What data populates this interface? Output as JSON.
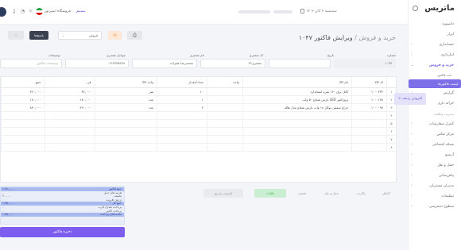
{
  "sidebar": {
    "brand": "ماتریس",
    "items": [
      {
        "label": "داشبورد",
        "type": "plain"
      },
      {
        "label": "ابزار",
        "type": "plain"
      },
      {
        "label": "حسابداری",
        "type": "collapsed"
      },
      {
        "label": "انبارداری",
        "type": "collapsed"
      },
      {
        "label": "خرید و فروش",
        "type": "open"
      },
      {
        "label": "ثبت فاکتور",
        "type": "sub"
      },
      {
        "label": "لیست فاکتورها",
        "type": "sub-active"
      },
      {
        "label": "گزارش",
        "type": "collapsed"
      },
      {
        "label": "خزانه داری",
        "type": "collapsed"
      },
      {
        "label": "مدیریت وظایف",
        "type": "group"
      },
      {
        "label": "کنترل سفارشات",
        "type": "collapsed"
      },
      {
        "label": "مرکز تماس",
        "type": "collapsed"
      },
      {
        "label": "شبکه اجتماعی",
        "type": "collapsed"
      },
      {
        "label": "آرشیو",
        "type": "collapsed"
      },
      {
        "label": "حمل و نقل",
        "type": "collapsed"
      },
      {
        "label": "پیام‌رسانی",
        "type": "collapsed"
      },
      {
        "label": "مدیران مشتریان",
        "type": "collapsed"
      },
      {
        "label": "تنظیمات",
        "type": "collapsed"
      },
      {
        "label": "سطوح دسترسی",
        "type": "collapsed"
      }
    ]
  },
  "topbar": {
    "user": "ممیم",
    "store": "فروشگاه ایمپرتور",
    "date": "سه‌شنبه ۲ آبان ۱۴۰۲"
  },
  "breadcrumb": {
    "root": "خرید و فروش",
    "current": "ویرایش فاکتور ۱۰۴۷"
  },
  "toolbar": {
    "print_icon": "printer-icon",
    "share_icon": "share-icon",
    "select_value": "فروش",
    "submit_label": "پاسخ‌ها",
    "prev_icon": "chevron-left-icon"
  },
  "form": {
    "serial_label": "شماره",
    "serial_value": "۱۰۴۷",
    "date_label": "تاریخ",
    "date_value": "",
    "customer_label": "کد مشتری",
    "customer_value": "مشتری۲۲",
    "name_label": "نام مشتری",
    "name_value": "محمدرضا علیزاده",
    "phone_label": "موبایل مشتری",
    "phone_value": "۰۹۱۲۳۴۵۶۷۸",
    "notes_label": "توضیحات",
    "notes_placeholder": "توضیحات فاکتور"
  },
  "table": {
    "headers": [
      "",
      "کد کالا",
      "نام کالا",
      "واحد",
      "تعداد/مقدار",
      "واحد کالا",
      "فی",
      "جمع"
    ],
    "rows": [
      {
        "n": "۱",
        "code": "۱۰۰۰۲۳۴",
        "name": "کابل برق ۱۶۰ نمره استاندارد",
        "unit": "",
        "qty": "۱۰",
        "uname": "متر",
        "price": "۳۶,۰۰۰",
        "total": "۳۶۰,۰۰۰"
      },
      {
        "n": "۲",
        "code": "۱۰۰۰۱۷۸",
        "name": "پروژکتور LED پارس شعاع ۵۰ وات",
        "unit": "",
        "qty": "۱",
        "uname": "عدد",
        "price": "۱۸۰,۰۰۰",
        "total": "۱۸۰,۰۰۰"
      },
      {
        "n": "۳",
        "code": "۱۰۰۰۰۹۷",
        "name": "چراغ سقفی توکار ۱۸ وات پارس شعاع مدل هاله",
        "unit": "",
        "qty": "۲",
        "uname": "عدد",
        "price": "۴۲۰,۰۰۰",
        "total": "۸۴۰,۰۰۰"
      },
      {
        "n": "۴",
        "code": "",
        "name": "",
        "unit": "",
        "qty": "",
        "uname": "",
        "price": "",
        "total": ""
      },
      {
        "n": "۵",
        "code": "",
        "name": "",
        "unit": "",
        "qty": "",
        "uname": "",
        "price": "",
        "total": ""
      },
      {
        "n": "۶",
        "code": "",
        "name": "",
        "unit": "",
        "qty": "",
        "uname": "",
        "price": "",
        "total": ""
      },
      {
        "n": "۷",
        "code": "",
        "name": "",
        "unit": "",
        "qty": "",
        "uname": "",
        "price": "",
        "total": ""
      },
      {
        "n": "۸",
        "code": "",
        "name": "",
        "unit": "",
        "qty": "",
        "uname": "",
        "price": "",
        "total": ""
      }
    ],
    "add_row_label": "+ افزودن ردیف"
  },
  "actions": {
    "a1": "الحاق",
    "a2": "پاکردن",
    "a3": "حمل و نقل",
    "a4": "تخفیف",
    "a5": "مالیات",
    "a6": "افزودن سریع"
  },
  "summary": {
    "rows": [
      {
        "label": "جمع فاکتور",
        "value": "۱,۳۸۰,۰۰۰",
        "hl": true
      },
      {
        "label": "هزینه های حمل",
        "value": "۰",
        "hl": false
      },
      {
        "label": "تخفیف",
        "value": "۳۰,۰۰۰",
        "hl": false
      },
      {
        "label": "ارزش افزوده",
        "value": "۰",
        "hl": false
      },
      {
        "label": "جمع کل",
        "value": "۱,۳۵۰,۰۰۰",
        "hl": true
      },
      {
        "label": "پرداخت نقدی/ کارت",
        "value": "۰",
        "hl": false
      },
      {
        "label": "پرداخت آنلاین",
        "value": "۰",
        "hl": false
      },
      {
        "label": "مانده قابل پرداخت",
        "value": "۱,۳۵۰,۰۰۰",
        "hl": true
      }
    ],
    "save_label": "ذخیره فاکتور"
  }
}
